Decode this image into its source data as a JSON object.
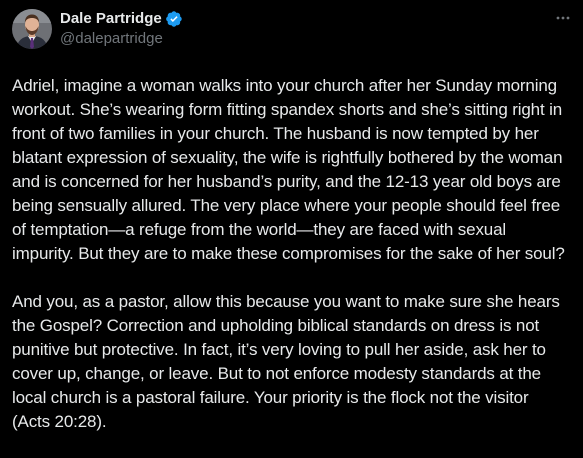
{
  "author": {
    "display_name": "Dale Partridge",
    "handle": "@dalepartridge",
    "verified": true,
    "avatar_icon": "profile-photo",
    "verified_color": "#1d9bf0"
  },
  "menu": {
    "more_icon": "more-horizontal-icon"
  },
  "post": {
    "paragraphs": [
      "Adriel, imagine a woman walks into your church after her Sunday morning workout. She’s wearing form fitting spandex shorts and she’s sitting right in front of two families in your church. The husband is now tempted by her blatant expression of sexuality, the wife is rightfully bothered by the woman and is concerned for her husband’s purity, and the 12-13 year old boys are being sensually allured. The very place where your people should feel free of temptation—a refuge from the world—they are faced with sexual impurity. But they are to make these compromises for the sake of her soul?",
      "And you, as a pastor, allow this because you want to make sure she hears the Gospel? Correction and upholding biblical standards on dress is not punitive but protective. In fact, it’s very loving to pull her aside, ask her to cover up, change, or leave. But to not enforce modesty standards at the local church is a pastoral failure. Your priority is the flock not the visitor (Acts 20:28)."
    ]
  },
  "colors": {
    "background": "#000000",
    "text": "#e7e9ea",
    "secondary_text": "#71767b"
  }
}
